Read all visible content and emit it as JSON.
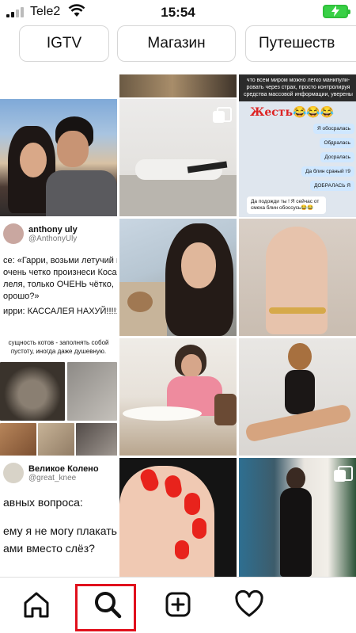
{
  "status_bar": {
    "carrier": "Tele2",
    "time": "15:54"
  },
  "categories": [
    "IGTV",
    "Магазин",
    "Путешеств"
  ],
  "tweet_1": {
    "name": "anthony uly",
    "handle": "@AnthonyUly",
    "lines": [
      "се: «Гарри, возьми летучий пор",
      "очень четко произнеси Косая",
      "леля, только ОЧЕНЬ чётко,",
      "орошо?»",
      "ирри: КАССАЛЕЯ НАХУЙ!!!!1!."
    ]
  },
  "tweet_2": {
    "name": "Великое Колено",
    "handle": "@great_knee",
    "lines": [
      "авных вопроса:",
      "ему я не могу плакать",
      "ами  вместо слёз?"
    ]
  },
  "cats_meme": {
    "caption": "сущность котов - заполнять собой пустоту, иногда даже душевную."
  },
  "chat_meme": {
    "header": "что всем миром можно легко манипули- ровать через страх, просто контролируя средства массовой информации, уверены",
    "title": "Жесть😂😂😂",
    "messages": [
      {
        "text": "Я обосралась",
        "dir": "out"
      },
      {
        "text": "Обдралась",
        "dir": "out"
      },
      {
        "text": "Досралась",
        "dir": "out"
      },
      {
        "text": "Да блин сраный т9",
        "dir": "out"
      },
      {
        "text": "ДОБРАЛАСЬ Я",
        "dir": "out"
      },
      {
        "text": "Да подожди ты ! Я сейчас от смеха блин обоссусь😂😂",
        "dir": "in"
      }
    ]
  },
  "tabbar": {
    "items": [
      "home",
      "search",
      "add",
      "activity"
    ]
  },
  "colors": {
    "highlight": "#e0101c",
    "battery": "#39d046",
    "nail_red": "#e8231c"
  }
}
